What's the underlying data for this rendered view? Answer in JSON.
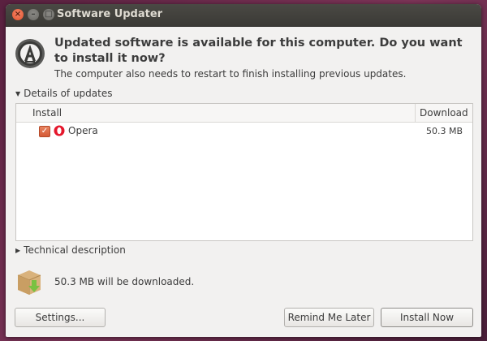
{
  "window": {
    "title": "Software Updater"
  },
  "titlebar": {
    "close_glyph": "×",
    "minimize_glyph": "–",
    "maximize_glyph": "□"
  },
  "header": {
    "headline": "Updated software is available for this computer. Do you want to install it now?",
    "subline": "The computer also needs to restart to finish installing previous updates.",
    "icon": "software-updater-icon"
  },
  "details": {
    "expander_label": "Details of updates",
    "expanded": true,
    "columns": {
      "install": "Install",
      "download": "Download"
    },
    "rows": [
      {
        "checked": true,
        "icon": "opera-icon",
        "name": "Opera",
        "size": "50.3 MB"
      }
    ]
  },
  "technical": {
    "expander_label": "Technical description",
    "expanded": false
  },
  "download_summary": {
    "text": "50.3 MB will be downloaded.",
    "icon": "package-download-icon"
  },
  "buttons": {
    "settings": "Settings...",
    "remind": "Remind Me Later",
    "install": "Install Now"
  },
  "colors": {
    "accent": "#e2502b",
    "titlebar": "#3b3a36",
    "window_bg": "#f2f1f0"
  }
}
